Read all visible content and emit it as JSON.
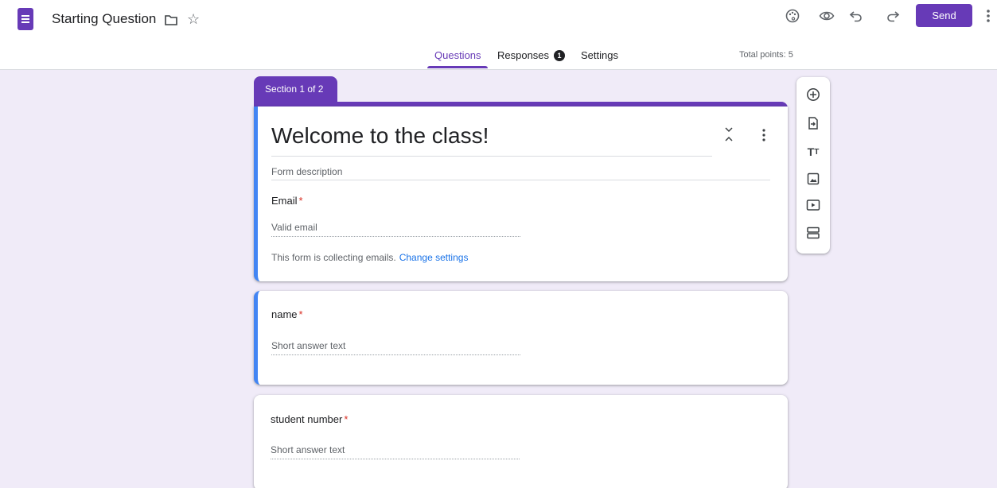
{
  "header": {
    "doc_title": "Starting Question",
    "send_label": "Send",
    "icons": [
      "folder-icon",
      "star-icon",
      "palette-icon",
      "preview-eye-icon",
      "undo-icon",
      "redo-icon",
      "more-vert-icon"
    ]
  },
  "tabs": [
    {
      "label": "Questions",
      "active": true
    },
    {
      "label": "Responses",
      "badge": "1"
    },
    {
      "label": "Settings"
    }
  ],
  "total_points": "Total points: 5",
  "section_label": "Section 1 of 2",
  "form": {
    "title": "Welcome to the class!",
    "description_placeholder": "Form description",
    "email_label": "Email",
    "email_placeholder": "Valid email",
    "collecting_note": "This form is collecting emails.",
    "change_settings": "Change settings",
    "required_mark": "*"
  },
  "questions": [
    {
      "label": "name",
      "placeholder": "Short answer text"
    },
    {
      "label": "student number",
      "placeholder": "Short answer text"
    }
  ],
  "toolbar": [
    "add-question-icon",
    "import-questions-icon",
    "add-title-icon",
    "add-image-icon",
    "add-video-icon",
    "add-section-icon"
  ],
  "colors": {
    "accent": "#673ab7",
    "background": "#f0ebf8",
    "selected_border": "#4285f4",
    "link": "#1a73e8",
    "required": "#d93025"
  }
}
